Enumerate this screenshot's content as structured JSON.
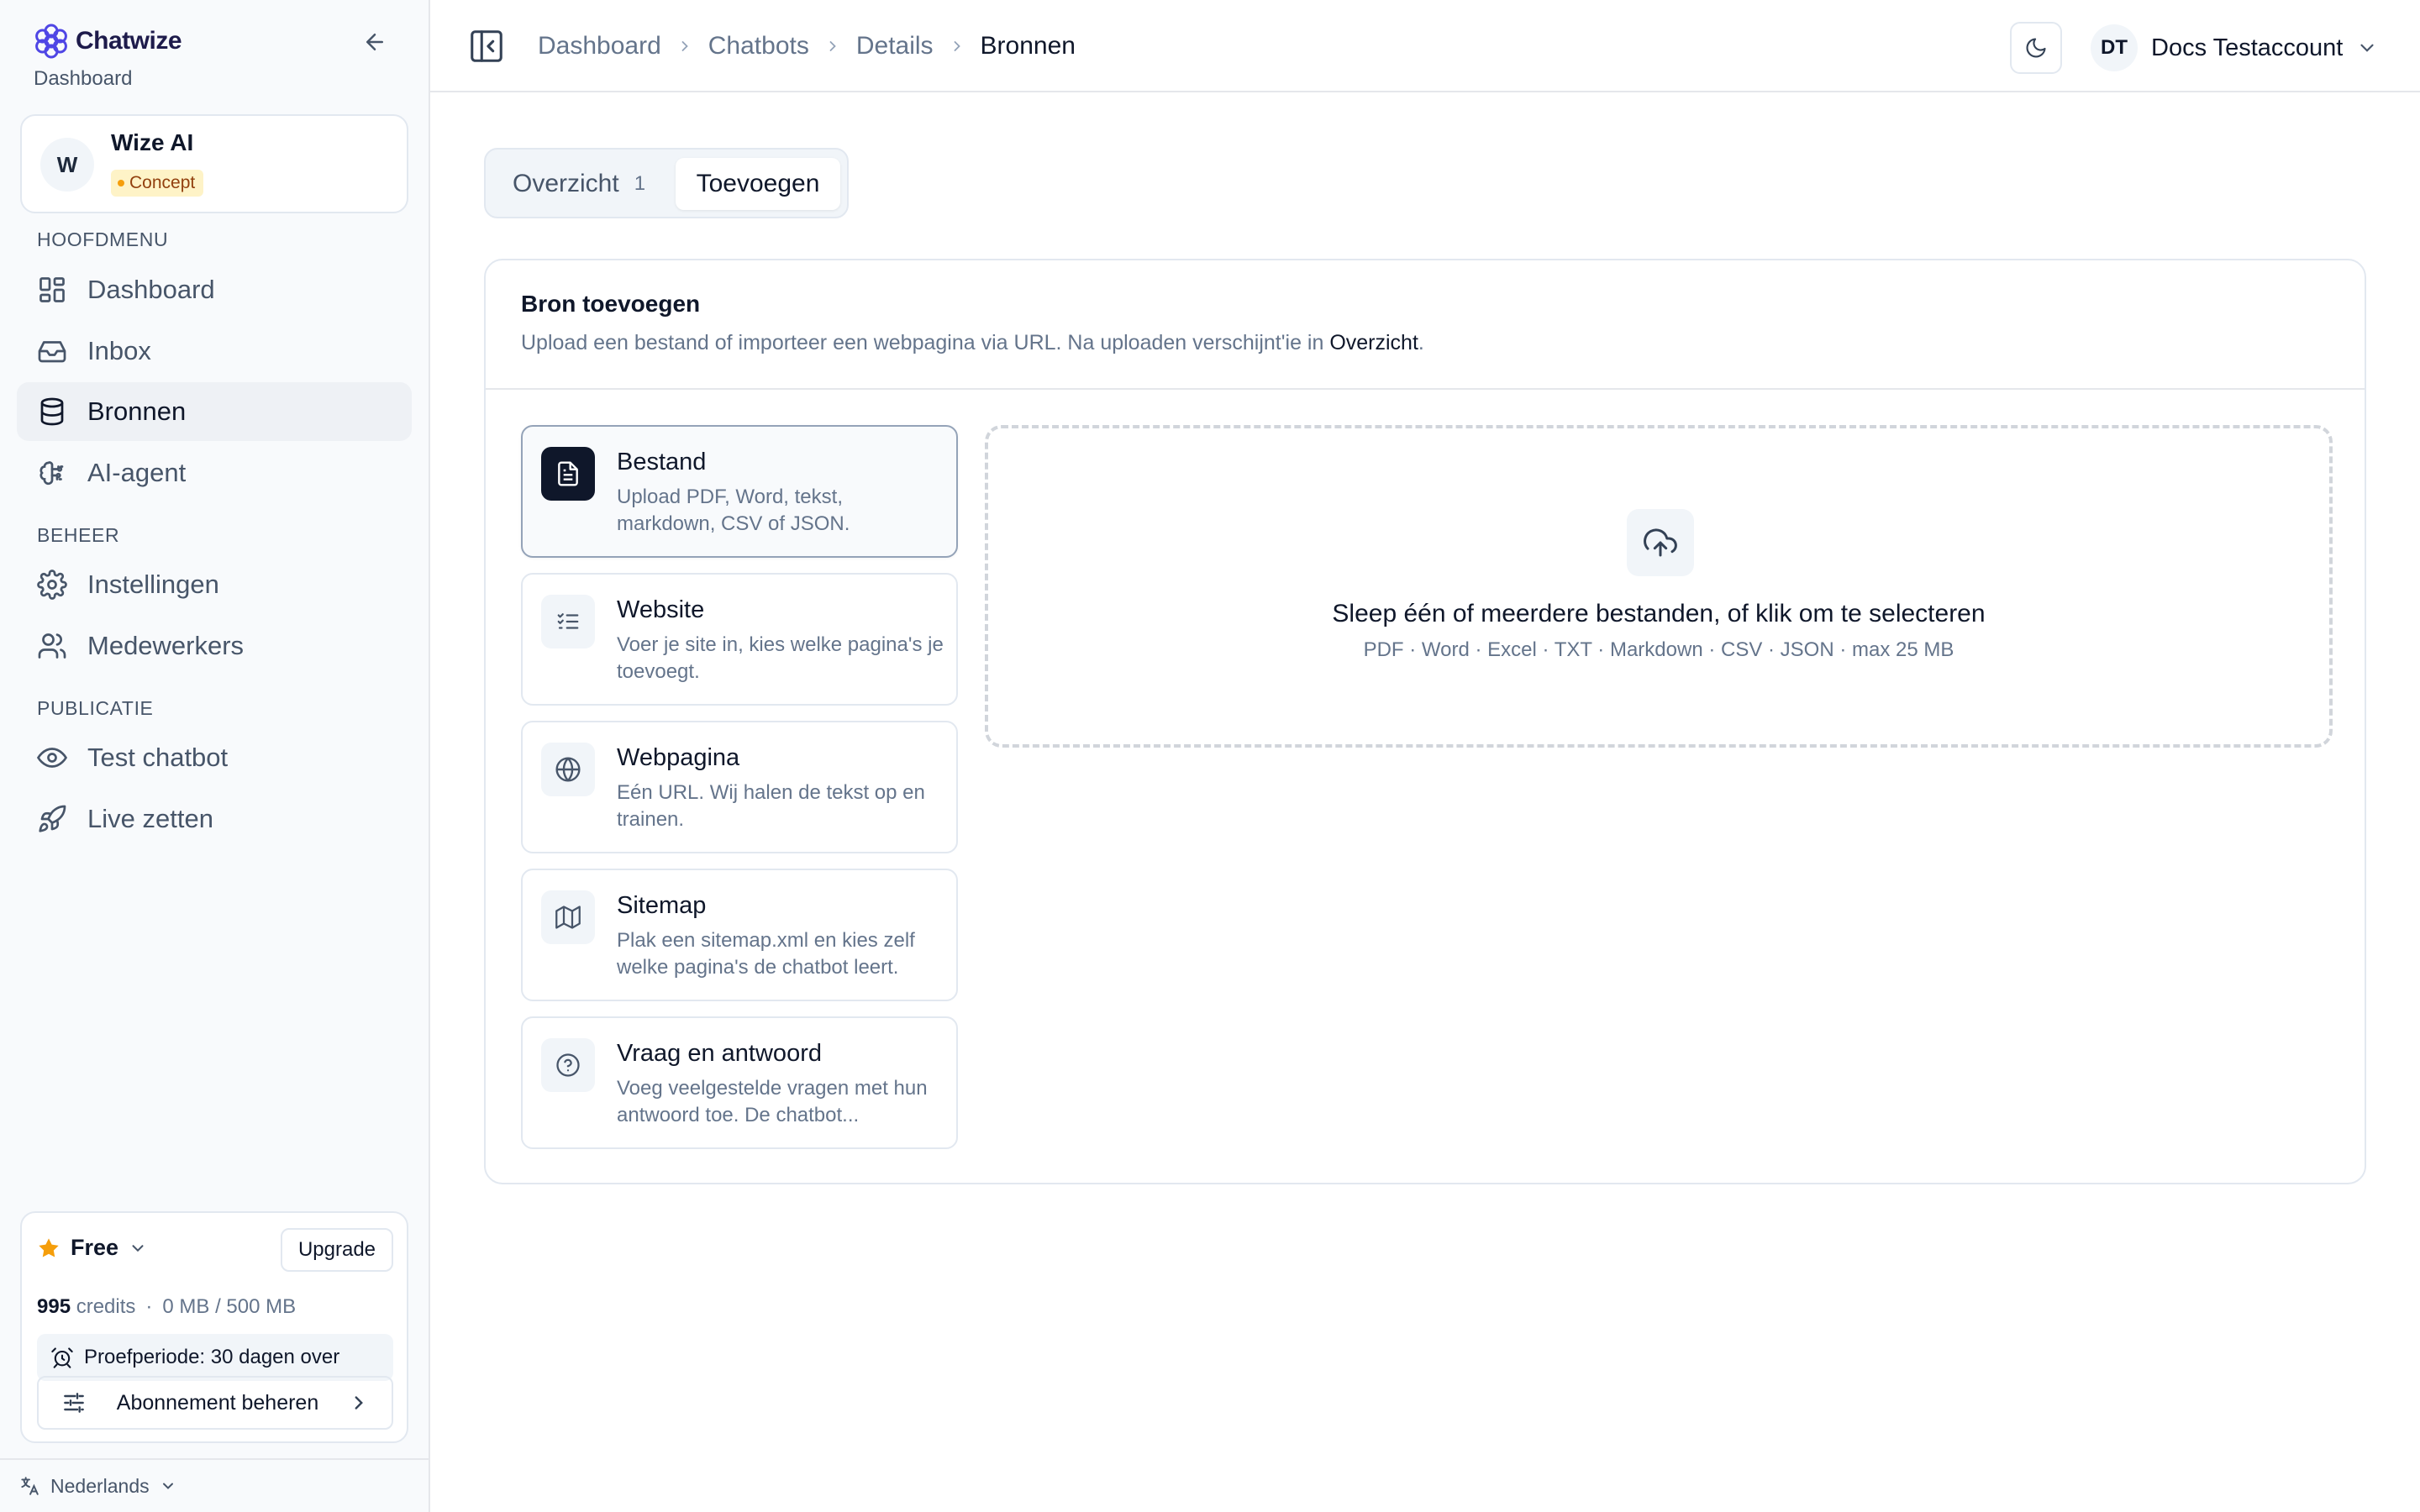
{
  "app": {
    "name": "Chatwize",
    "subtitle": "Dashboard"
  },
  "bot": {
    "avatar": "W",
    "name": "Wize AI",
    "status": "Concept"
  },
  "sidebar": {
    "sections": [
      "HOOFDMENU",
      "BEHEER",
      "PUBLICATIE"
    ],
    "items": [
      {
        "label": "Dashboard",
        "icon": "dashboard-icon"
      },
      {
        "label": "Inbox",
        "icon": "inbox-icon"
      },
      {
        "label": "Bronnen",
        "icon": "database-icon",
        "active": true
      },
      {
        "label": "AI-agent",
        "icon": "brain-icon"
      },
      {
        "label": "Instellingen",
        "icon": "gear-icon"
      },
      {
        "label": "Medewerkers",
        "icon": "users-icon"
      },
      {
        "label": "Test chatbot",
        "icon": "eye-icon"
      },
      {
        "label": "Live zetten",
        "icon": "rocket-icon"
      }
    ]
  },
  "plan": {
    "name": "Free",
    "upgrade_label": "Upgrade",
    "credits_value": "995",
    "credits_label": "credits",
    "storage": "0 MB / 500 MB",
    "trial_prefix": "Proefperiode:",
    "trial_value": "30 dagen over",
    "manage_label": "Abonnement beheren"
  },
  "language": "Nederlands",
  "breadcrumb": [
    "Dashboard",
    "Chatbots",
    "Details",
    "Bronnen"
  ],
  "user": {
    "initials": "DT",
    "name": "Docs Testaccount"
  },
  "tabs": [
    {
      "label": "Overzicht",
      "count": "1"
    },
    {
      "label": "Toevoegen",
      "active": true
    }
  ],
  "add_source": {
    "title": "Bron toevoegen",
    "description_prefix": "Upload een bestand of importeer een webpagina via URL. Na uploaden verschijnt'ie in ",
    "description_link": "Overzicht",
    "description_suffix": "."
  },
  "options": [
    {
      "title": "Bestand",
      "desc": "Upload PDF, Word, tekst, markdown, CSV of JSON.",
      "icon": "file-icon",
      "selected": true
    },
    {
      "title": "Website",
      "desc": "Voer je site in, kies welke pagina's je toevoegt.",
      "icon": "list-check-icon"
    },
    {
      "title": "Webpagina",
      "desc": "Eén URL. Wij halen de tekst op en trainen.",
      "icon": "globe-icon"
    },
    {
      "title": "Sitemap",
      "desc": "Plak een sitemap.xml en kies zelf welke pagina's de chatbot leert.",
      "icon": "map-icon"
    },
    {
      "title": "Vraag en antwoord",
      "desc": "Voeg veelgestelde vragen met hun antwoord toe. De chatbot...",
      "icon": "help-circle-icon"
    }
  ],
  "dropzone": {
    "title": "Sleep één of meerdere bestanden, of klik om te selecteren",
    "formats": "PDF · Word · Excel · TXT · Markdown · CSV · JSON · max 25 MB",
    "icon": "cloud-upload-icon"
  },
  "colors": {
    "accent": "#0f172a",
    "brand": "#4f46e5",
    "badge_bg": "#fef3c7",
    "badge_dot": "#f59e0b",
    "star": "#f59e0b"
  }
}
